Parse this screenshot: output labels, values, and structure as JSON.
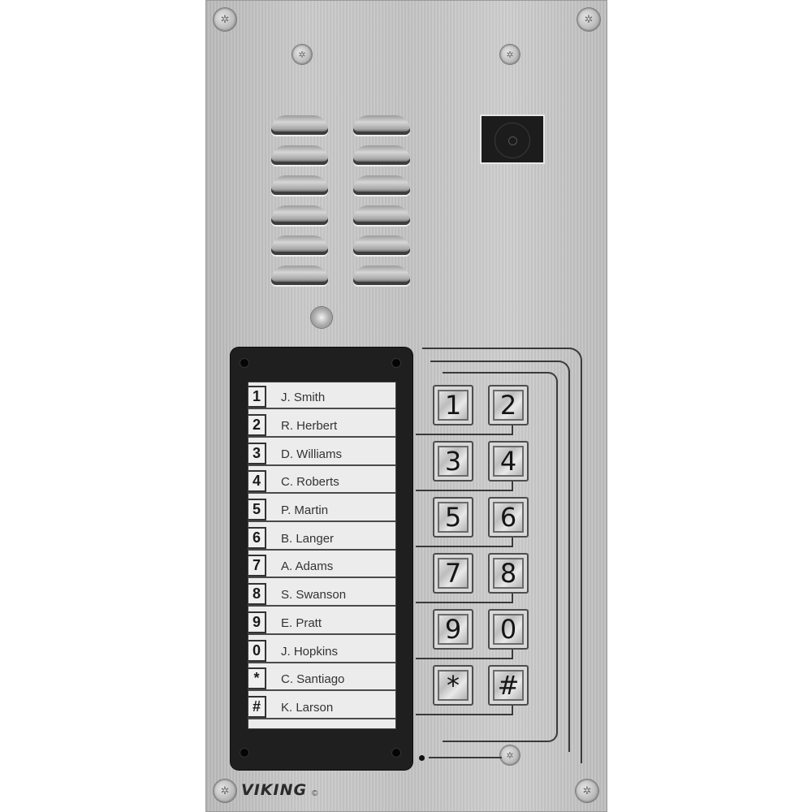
{
  "device": {
    "brand": "VIKING",
    "brand_mark": "©",
    "type": "entry-phone-panel"
  },
  "directory": {
    "entries": [
      {
        "key": "1",
        "name": "J. Smith"
      },
      {
        "key": "2",
        "name": "R. Herbert"
      },
      {
        "key": "3",
        "name": "D. Williams"
      },
      {
        "key": "4",
        "name": "C. Roberts"
      },
      {
        "key": "5",
        "name": "P. Martin"
      },
      {
        "key": "6",
        "name": "B. Langer"
      },
      {
        "key": "7",
        "name": "A. Adams"
      },
      {
        "key": "8",
        "name": "S. Swanson"
      },
      {
        "key": "9",
        "name": "E. Pratt"
      },
      {
        "key": "0",
        "name": "J. Hopkins"
      },
      {
        "key": "*",
        "name": "C. Santiago"
      },
      {
        "key": "#",
        "name": "K. Larson"
      }
    ]
  },
  "keypad": {
    "keys": [
      "1",
      "2",
      "3",
      "4",
      "5",
      "6",
      "7",
      "8",
      "9",
      "0",
      "*",
      "#"
    ]
  },
  "icons": {
    "screw": "✲"
  },
  "colors": {
    "panel": "#c4c4c4",
    "frame": "#1f1f1f",
    "card": "#ececec"
  }
}
